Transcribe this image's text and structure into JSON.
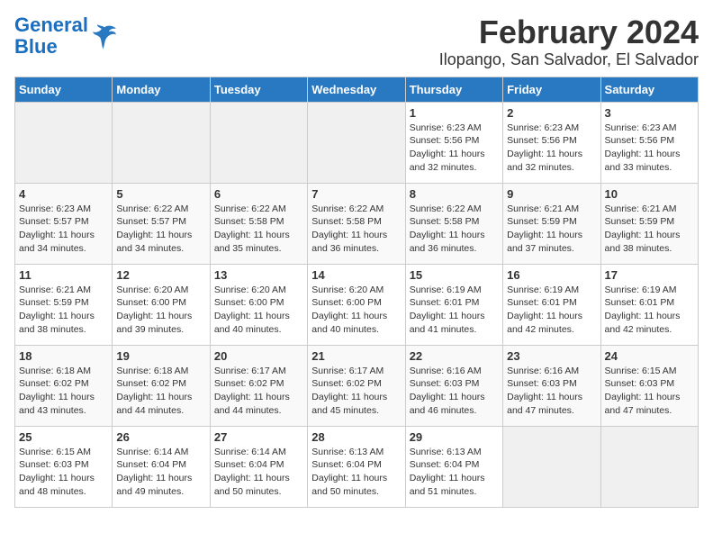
{
  "app": {
    "name": "GeneralBlue",
    "logo_text_part1": "General",
    "logo_text_part2": "Blue"
  },
  "calendar": {
    "title": "February 2024",
    "subtitle": "Ilopango, San Salvador, El Salvador",
    "days_of_week": [
      "Sunday",
      "Monday",
      "Tuesday",
      "Wednesday",
      "Thursday",
      "Friday",
      "Saturday"
    ],
    "weeks": [
      [
        {
          "num": "",
          "info": ""
        },
        {
          "num": "",
          "info": ""
        },
        {
          "num": "",
          "info": ""
        },
        {
          "num": "",
          "info": ""
        },
        {
          "num": "1",
          "info": "Sunrise: 6:23 AM\nSunset: 5:56 PM\nDaylight: 11 hours\nand 32 minutes."
        },
        {
          "num": "2",
          "info": "Sunrise: 6:23 AM\nSunset: 5:56 PM\nDaylight: 11 hours\nand 32 minutes."
        },
        {
          "num": "3",
          "info": "Sunrise: 6:23 AM\nSunset: 5:56 PM\nDaylight: 11 hours\nand 33 minutes."
        }
      ],
      [
        {
          "num": "4",
          "info": "Sunrise: 6:23 AM\nSunset: 5:57 PM\nDaylight: 11 hours\nand 34 minutes."
        },
        {
          "num": "5",
          "info": "Sunrise: 6:22 AM\nSunset: 5:57 PM\nDaylight: 11 hours\nand 34 minutes."
        },
        {
          "num": "6",
          "info": "Sunrise: 6:22 AM\nSunset: 5:58 PM\nDaylight: 11 hours\nand 35 minutes."
        },
        {
          "num": "7",
          "info": "Sunrise: 6:22 AM\nSunset: 5:58 PM\nDaylight: 11 hours\nand 36 minutes."
        },
        {
          "num": "8",
          "info": "Sunrise: 6:22 AM\nSunset: 5:58 PM\nDaylight: 11 hours\nand 36 minutes."
        },
        {
          "num": "9",
          "info": "Sunrise: 6:21 AM\nSunset: 5:59 PM\nDaylight: 11 hours\nand 37 minutes."
        },
        {
          "num": "10",
          "info": "Sunrise: 6:21 AM\nSunset: 5:59 PM\nDaylight: 11 hours\nand 38 minutes."
        }
      ],
      [
        {
          "num": "11",
          "info": "Sunrise: 6:21 AM\nSunset: 5:59 PM\nDaylight: 11 hours\nand 38 minutes."
        },
        {
          "num": "12",
          "info": "Sunrise: 6:20 AM\nSunset: 6:00 PM\nDaylight: 11 hours\nand 39 minutes."
        },
        {
          "num": "13",
          "info": "Sunrise: 6:20 AM\nSunset: 6:00 PM\nDaylight: 11 hours\nand 40 minutes."
        },
        {
          "num": "14",
          "info": "Sunrise: 6:20 AM\nSunset: 6:00 PM\nDaylight: 11 hours\nand 40 minutes."
        },
        {
          "num": "15",
          "info": "Sunrise: 6:19 AM\nSunset: 6:01 PM\nDaylight: 11 hours\nand 41 minutes."
        },
        {
          "num": "16",
          "info": "Sunrise: 6:19 AM\nSunset: 6:01 PM\nDaylight: 11 hours\nand 42 minutes."
        },
        {
          "num": "17",
          "info": "Sunrise: 6:19 AM\nSunset: 6:01 PM\nDaylight: 11 hours\nand 42 minutes."
        }
      ],
      [
        {
          "num": "18",
          "info": "Sunrise: 6:18 AM\nSunset: 6:02 PM\nDaylight: 11 hours\nand 43 minutes."
        },
        {
          "num": "19",
          "info": "Sunrise: 6:18 AM\nSunset: 6:02 PM\nDaylight: 11 hours\nand 44 minutes."
        },
        {
          "num": "20",
          "info": "Sunrise: 6:17 AM\nSunset: 6:02 PM\nDaylight: 11 hours\nand 44 minutes."
        },
        {
          "num": "21",
          "info": "Sunrise: 6:17 AM\nSunset: 6:02 PM\nDaylight: 11 hours\nand 45 minutes."
        },
        {
          "num": "22",
          "info": "Sunrise: 6:16 AM\nSunset: 6:03 PM\nDaylight: 11 hours\nand 46 minutes."
        },
        {
          "num": "23",
          "info": "Sunrise: 6:16 AM\nSunset: 6:03 PM\nDaylight: 11 hours\nand 47 minutes."
        },
        {
          "num": "24",
          "info": "Sunrise: 6:15 AM\nSunset: 6:03 PM\nDaylight: 11 hours\nand 47 minutes."
        }
      ],
      [
        {
          "num": "25",
          "info": "Sunrise: 6:15 AM\nSunset: 6:03 PM\nDaylight: 11 hours\nand 48 minutes."
        },
        {
          "num": "26",
          "info": "Sunrise: 6:14 AM\nSunset: 6:04 PM\nDaylight: 11 hours\nand 49 minutes."
        },
        {
          "num": "27",
          "info": "Sunrise: 6:14 AM\nSunset: 6:04 PM\nDaylight: 11 hours\nand 50 minutes."
        },
        {
          "num": "28",
          "info": "Sunrise: 6:13 AM\nSunset: 6:04 PM\nDaylight: 11 hours\nand 50 minutes."
        },
        {
          "num": "29",
          "info": "Sunrise: 6:13 AM\nSunset: 6:04 PM\nDaylight: 11 hours\nand 51 minutes."
        },
        {
          "num": "",
          "info": ""
        },
        {
          "num": "",
          "info": ""
        }
      ]
    ]
  }
}
